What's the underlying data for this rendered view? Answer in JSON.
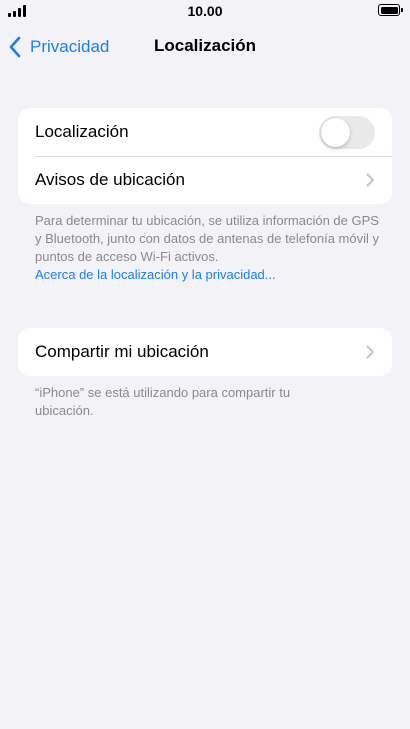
{
  "status_bar": {
    "time": "10.00"
  },
  "nav": {
    "back_label": "Privacidad",
    "title": "Localización"
  },
  "location_group": {
    "location_label": "Localización",
    "location_enabled": false,
    "alerts_label": "Avisos de ubicación"
  },
  "location_footer": {
    "text": "Para determinar tu ubicación, se utiliza información de GPS y Bluetooth, junto con datos de antenas de telefonía móvil y puntos de acceso Wi-Fi activos.",
    "link": "Acerca de la localización y la privacidad..."
  },
  "share_group": {
    "share_label": "Compartir mi ubicación"
  },
  "share_footer": {
    "text": "“iPhone” se está utilizando para compartir tu ubicación."
  },
  "colors": {
    "accent": "#1a7ff5",
    "background": "#f2f2f7",
    "toggle_off": "#e9e9ea"
  }
}
